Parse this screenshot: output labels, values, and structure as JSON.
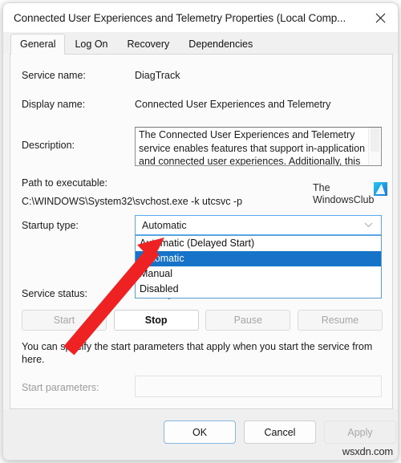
{
  "window": {
    "title": "Connected User Experiences and Telemetry Properties (Local Comp...",
    "close_label": "✕"
  },
  "tabs": [
    {
      "label": "General",
      "active": true
    },
    {
      "label": "Log On",
      "active": false
    },
    {
      "label": "Recovery",
      "active": false
    },
    {
      "label": "Dependencies",
      "active": false
    }
  ],
  "fields": {
    "service_name_label": "Service name:",
    "service_name_value": "DiagTrack",
    "display_name_label": "Display name:",
    "display_name_value": "Connected User Experiences and Telemetry",
    "description_label": "Description:",
    "description_value": "The Connected User Experiences and Telemetry service enables features that support in-application and connected user experiences. Additionally, this",
    "path_label": "Path to executable:",
    "path_value": "C:\\WINDOWS\\System32\\svchost.exe -k utcsvc -p",
    "startup_type_label": "Startup type:",
    "startup_type_value": "Automatic",
    "service_status_label": "Service status:",
    "service_status_value": "Running",
    "start_parameters_label": "Start parameters:",
    "start_parameters_value": ""
  },
  "startup_options": [
    {
      "label": "Automatic (Delayed Start)",
      "selected": false
    },
    {
      "label": "Automatic",
      "selected": true
    },
    {
      "label": "Manual",
      "selected": false
    },
    {
      "label": "Disabled",
      "selected": false
    }
  ],
  "service_buttons": [
    {
      "label": "Start",
      "enabled": false
    },
    {
      "label": "Stop",
      "enabled": true
    },
    {
      "label": "Pause",
      "enabled": false
    },
    {
      "label": "Resume",
      "enabled": false
    }
  ],
  "hint_text": "You can specify the start parameters that apply when you start the service from here.",
  "footer": {
    "ok_label": "OK",
    "cancel_label": "Cancel",
    "apply_label": "Apply"
  },
  "watermarks": {
    "logo_line1": "The",
    "logo_line2": "WindowsClub",
    "site": "wsxdn.com"
  },
  "colors": {
    "selection_blue": "#1673c8",
    "focus_blue": "#5aaaf0",
    "annotation_red": "#ee2222",
    "logo_gradient_from": "#23c7f0",
    "logo_gradient_to": "#1e74d8"
  }
}
